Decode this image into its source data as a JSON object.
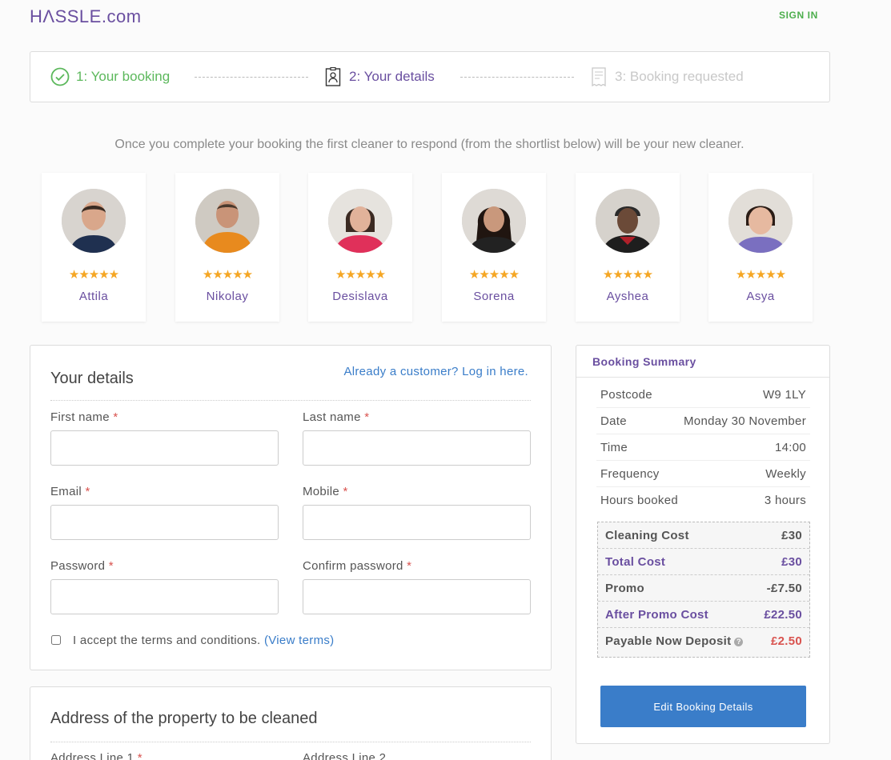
{
  "header": {
    "logo": "HΛSSLE.com",
    "sign_in": "SIGN IN"
  },
  "steps": [
    {
      "label": "1: Your booking",
      "state": "complete",
      "icon": "check-circle-icon"
    },
    {
      "label": "2: Your details",
      "state": "active",
      "icon": "id-badge-icon"
    },
    {
      "label": "3: Booking requested",
      "state": "pending",
      "icon": "receipt-icon"
    }
  ],
  "intro": "Once you complete your booking the first cleaner to respond (from the shortlist below) will be your new cleaner.",
  "cleaners": [
    {
      "name": "Attila",
      "rating": 5
    },
    {
      "name": "Nikolay",
      "rating": 5
    },
    {
      "name": "Desislava",
      "rating": 5
    },
    {
      "name": "Sorena",
      "rating": 5
    },
    {
      "name": "Ayshea",
      "rating": 5
    },
    {
      "name": "Asya",
      "rating": 5
    }
  ],
  "stars_text": "★★★★★",
  "details": {
    "title": "Your details",
    "login_link": "Already a customer? Log in here.",
    "required_mark": "*",
    "first_name": "First name",
    "last_name": "Last name",
    "email": "Email",
    "mobile": "Mobile",
    "password": "Password",
    "confirm_password": "Confirm password",
    "terms": "I accept the terms and conditions.",
    "view_terms": "(View terms)"
  },
  "address": {
    "title": "Address of the property to be cleaned",
    "line1": "Address Line 1",
    "line2": "Address Line 2"
  },
  "summary": {
    "title": "Booking Summary",
    "rows": [
      {
        "label": "Postcode",
        "value": "W9 1LY"
      },
      {
        "label": "Date",
        "value": "Monday 30 November"
      },
      {
        "label": "Time",
        "value": "14:00"
      },
      {
        "label": "Frequency",
        "value": "Weekly"
      },
      {
        "label": "Hours booked",
        "value": "3 hours"
      }
    ],
    "costs": {
      "cleaning_label": "Cleaning Cost",
      "cleaning_value": "£30",
      "total_label": "Total Cost",
      "total_value": "£30",
      "promo_label": "Promo",
      "promo_value": "-£7.50",
      "after_label": "After Promo Cost",
      "after_value": "£22.50",
      "deposit_label": "Payable Now Deposit",
      "deposit_value": "£2.50"
    },
    "edit_button": "Edit Booking Details"
  },
  "colors": {
    "brand_purple": "#6a4fa0",
    "success_green": "#5cb85c",
    "link_blue": "#3a7dc9",
    "danger_red": "#d9534f",
    "star_gold": "#f5a623"
  }
}
